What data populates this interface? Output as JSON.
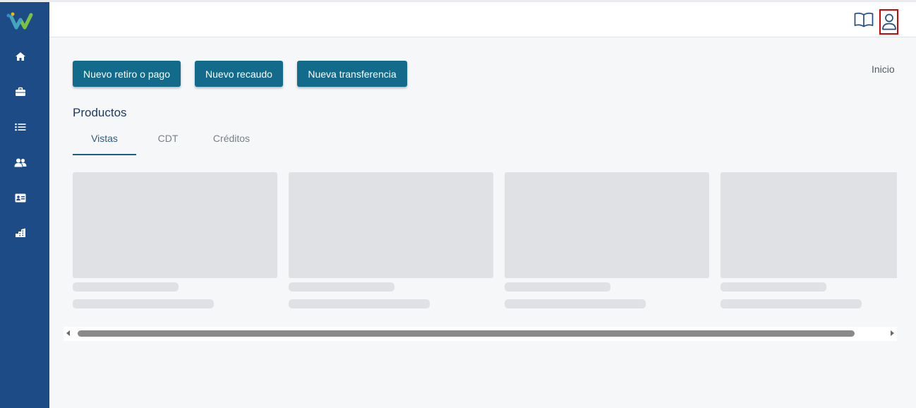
{
  "sidebar": {
    "logo": "company-logo",
    "items": [
      {
        "icon": "home-icon"
      },
      {
        "icon": "briefcase-icon"
      },
      {
        "icon": "list-icon"
      },
      {
        "icon": "users-icon"
      },
      {
        "icon": "id-card-icon"
      },
      {
        "icon": "building-icon"
      }
    ]
  },
  "header": {
    "book_icon": "book-open-icon",
    "user_icon": "user-icon"
  },
  "breadcrumb": "Inicio",
  "actions": {
    "new_withdrawal": "Nuevo retiro o pago",
    "new_collection": "Nuevo recaudo",
    "new_transfer": "Nueva transferencia"
  },
  "products": {
    "title": "Productos",
    "tabs": [
      "Vistas",
      "CDT",
      "Créditos"
    ],
    "active_tab": "Vistas"
  },
  "colors": {
    "sidebar": "#1d4b86",
    "primary_button": "#126b8a",
    "skeleton": "#dfe1e4",
    "highlight": "#e00000"
  }
}
